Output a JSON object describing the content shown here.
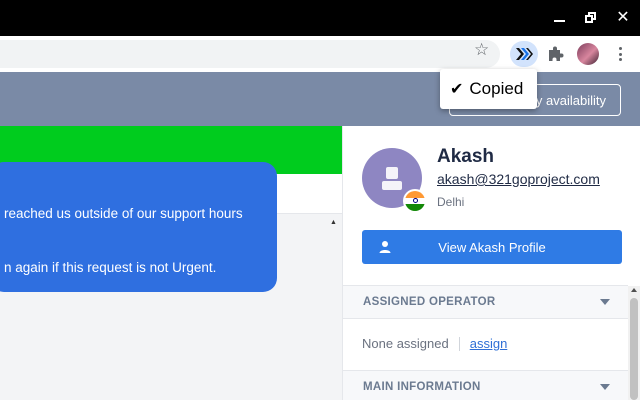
{
  "window_controls": {
    "close_glyph": "✕"
  },
  "header": {
    "availability_label": "y availability"
  },
  "tooltip": {
    "check": "✔",
    "text": "Copied"
  },
  "chat": {
    "line1": "reached us outside of our support hours",
    "line2": "n again if this request is not Urgent."
  },
  "contact": {
    "name": "Akash",
    "email": "akash@321goproject.com",
    "city": "Delhi",
    "view_profile_label": "View Akash Profile",
    "flag_icon": "india-flag-icon"
  },
  "sections": {
    "assigned_operator": {
      "title": "ASSIGNED OPERATOR",
      "status": "None assigned",
      "action": "assign"
    },
    "main_information": {
      "title": "MAIN INFORMATION"
    }
  },
  "colors": {
    "header_band": "#7a8aa6",
    "green_bar": "#00cc1e",
    "primary_blue": "#2f7be5",
    "bubble_blue": "#2f6fe0"
  }
}
